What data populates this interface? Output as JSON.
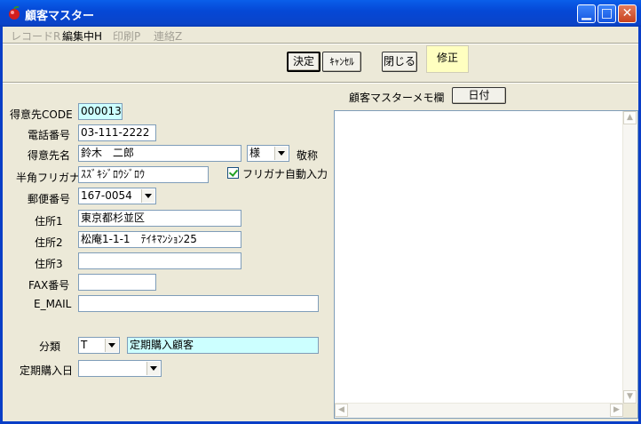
{
  "window": {
    "title": "顧客マスター"
  },
  "menu": [
    {
      "label": "レコードR",
      "disabled": true
    },
    {
      "label": "編集中H",
      "disabled": false
    },
    {
      "label": "印刷P",
      "disabled": true
    },
    {
      "label": "連絡Z",
      "disabled": true
    }
  ],
  "toolbar": {
    "decide": "決定",
    "cancel": "ｷｬﾝｾﾙ",
    "close": "閉じる",
    "mode": "修正"
  },
  "form": {
    "code": {
      "label": "得意先CODE",
      "value": "000013"
    },
    "phone": {
      "label": "電話番号",
      "value": "03-111-2222"
    },
    "name": {
      "label": "得意先名",
      "value": "鈴木　二郎"
    },
    "honorific": {
      "value": "様",
      "suffix": "敬称"
    },
    "kana": {
      "label": "半角フリガナ",
      "value": "ｽｽﾞｷｼﾞﾛｳｼﾞﾛｳ"
    },
    "kana_auto": {
      "label": "フリガナ自動入力",
      "checked": true
    },
    "postal": {
      "label": "郵便番号",
      "value": "167-0054"
    },
    "addr1": {
      "label": "住所1",
      "value": "東京都杉並区"
    },
    "addr2": {
      "label": "住所2",
      "value": "松庵1-1-1　ﾃｲｷﾏﾝｼｮﾝ25"
    },
    "addr3": {
      "label": "住所3",
      "value": ""
    },
    "fax": {
      "label": "FAX番号",
      "value": ""
    },
    "email": {
      "label": "E_MAIL",
      "value": ""
    },
    "category": {
      "label": "分類",
      "code": "T",
      "name": "定期購入顧客"
    },
    "purchase_date": {
      "label": "定期購入日",
      "value": ""
    }
  },
  "memo": {
    "label": "顧客マスターメモ欄",
    "date_button": "日付"
  }
}
